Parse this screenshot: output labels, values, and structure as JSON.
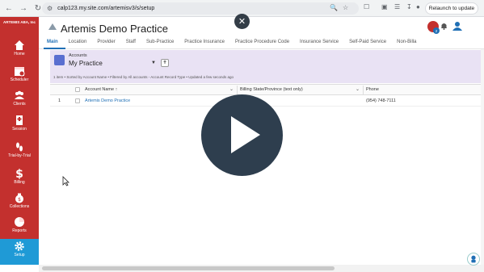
{
  "browser": {
    "url": "calp123.my.site.com/artemisv3/s/setup",
    "relaunch_label": "Relaunch to update"
  },
  "sidebar": {
    "brand": "ARTEMIS ABA, Inc",
    "items": [
      {
        "label": "Home",
        "icon": "home-icon"
      },
      {
        "label": "Scheduler",
        "icon": "calendar-icon"
      },
      {
        "label": "Clients",
        "icon": "people-icon"
      },
      {
        "label": "Session",
        "icon": "book-icon"
      },
      {
        "label": "Trial-by-Trial",
        "icon": "footprints-icon"
      },
      {
        "label": "Billing",
        "icon": "dollar-icon"
      },
      {
        "label": "Collections",
        "icon": "money-bag-icon"
      },
      {
        "label": "Reports",
        "icon": "pie-chart-icon"
      },
      {
        "label": "Setup",
        "icon": "gear-icon"
      }
    ],
    "active": "Setup"
  },
  "header": {
    "title": "Artemis Demo Practice",
    "tabs": [
      "Main",
      "Location",
      "Provider",
      "Staff",
      "Sub-Practice",
      "Practice Insurance",
      "Practice Procedure Code",
      "Insurance Service",
      "Self-Paid Service",
      "Non-Billa"
    ],
    "active_tab": "Main",
    "notification_count": "2"
  },
  "list_view": {
    "object_label": "Accounts",
    "view_name": "My Practice",
    "meta": "1 item • Sorted by Account Name • Filtered by All accounts - Account Record Type • Updated a few seconds ago",
    "columns": [
      "Account Name ↑",
      "Billing State/Province (text only)",
      "Phone"
    ],
    "rows": [
      {
        "num": "1",
        "account_name": "Artemis Demo Practice",
        "state": "",
        "phone": "(954) 748-7111"
      }
    ]
  },
  "colors": {
    "sidebar": "#c3302e",
    "sidebar_active": "#1f9ad6",
    "accent": "#1f6fb5",
    "list_header": "#e9e2f4",
    "play_overlay": "#2e3e4e"
  }
}
